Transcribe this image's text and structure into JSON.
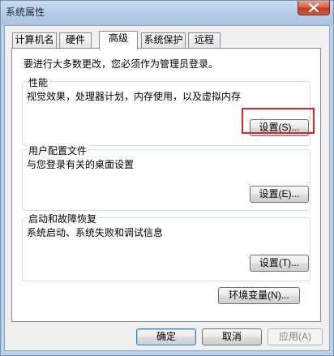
{
  "window": {
    "title": "系统属性"
  },
  "tabs": [
    {
      "label": "计算机名"
    },
    {
      "label": "硬件"
    },
    {
      "label": "高级"
    },
    {
      "label": "系统保护"
    },
    {
      "label": "远程"
    }
  ],
  "active_tab": "高级",
  "notice": "要进行大多数更改，您必须作为管理员登录。",
  "sections": {
    "performance": {
      "label": "性能",
      "description": "视觉效果，处理器计划，内存使用，以及虚拟内存",
      "button": "设置(S)..."
    },
    "user_profiles": {
      "label": "用户配置文件",
      "description": "与您登录有关的桌面设置",
      "button": "设置(E)..."
    },
    "startup_recovery": {
      "label": "启动和故障恢复",
      "description": "系统启动、系统失败和调试信息",
      "button": "设置(T)..."
    }
  },
  "env_button": "环境变量(N)...",
  "footer": {
    "ok": "确定",
    "cancel": "取消",
    "apply": "应用(A)"
  },
  "colors": {
    "highlight_box": "#e0232a",
    "close_button": "#c2391f"
  }
}
